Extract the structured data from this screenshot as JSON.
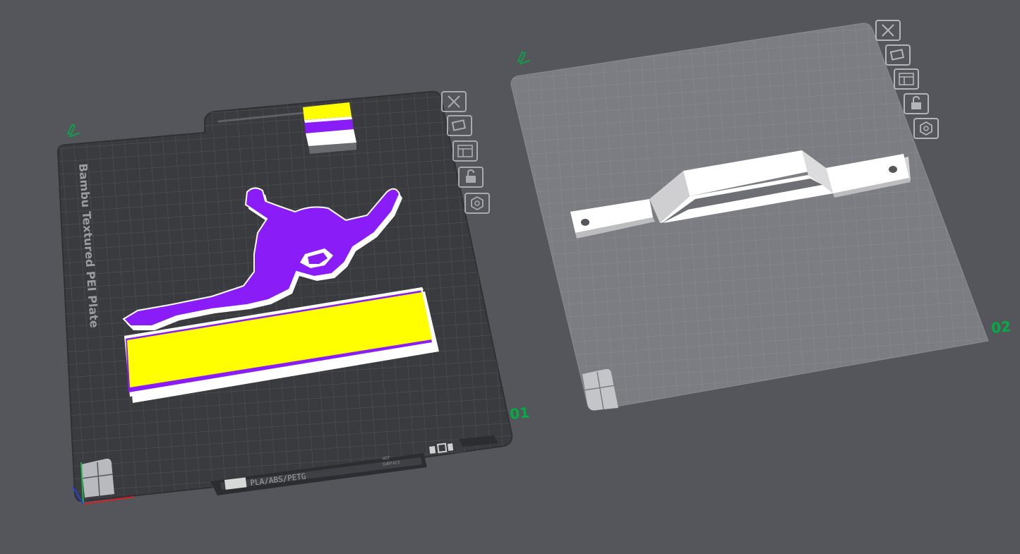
{
  "plate1": {
    "label": "01",
    "bed_name": "Bambu Textured PEI Plate",
    "strip_text": "PLA/ABS/PETG",
    "hot_line1": "HOT",
    "hot_line2": "SURFACE",
    "model": "gymnast-on-balance-beam",
    "colors": [
      "#ffff00",
      "#8a1cf7",
      "#ffffff"
    ]
  },
  "plate2": {
    "label": "02",
    "model": "beam-bracket"
  },
  "plate_tools": [
    {
      "name": "delete-plate",
      "icon": "close-icon"
    },
    {
      "name": "arrange-plate",
      "icon": "arrange-icon"
    },
    {
      "name": "plate-settings",
      "icon": "layout-icon"
    },
    {
      "name": "lock-plate",
      "icon": "lock-icon"
    },
    {
      "name": "orient-plate",
      "icon": "hexagon-icon"
    }
  ],
  "theme": {
    "background": "#55565b",
    "accent": "#00ae42",
    "bed_dark": "#3a3b3f",
    "bed_light": "#7b7d82"
  }
}
